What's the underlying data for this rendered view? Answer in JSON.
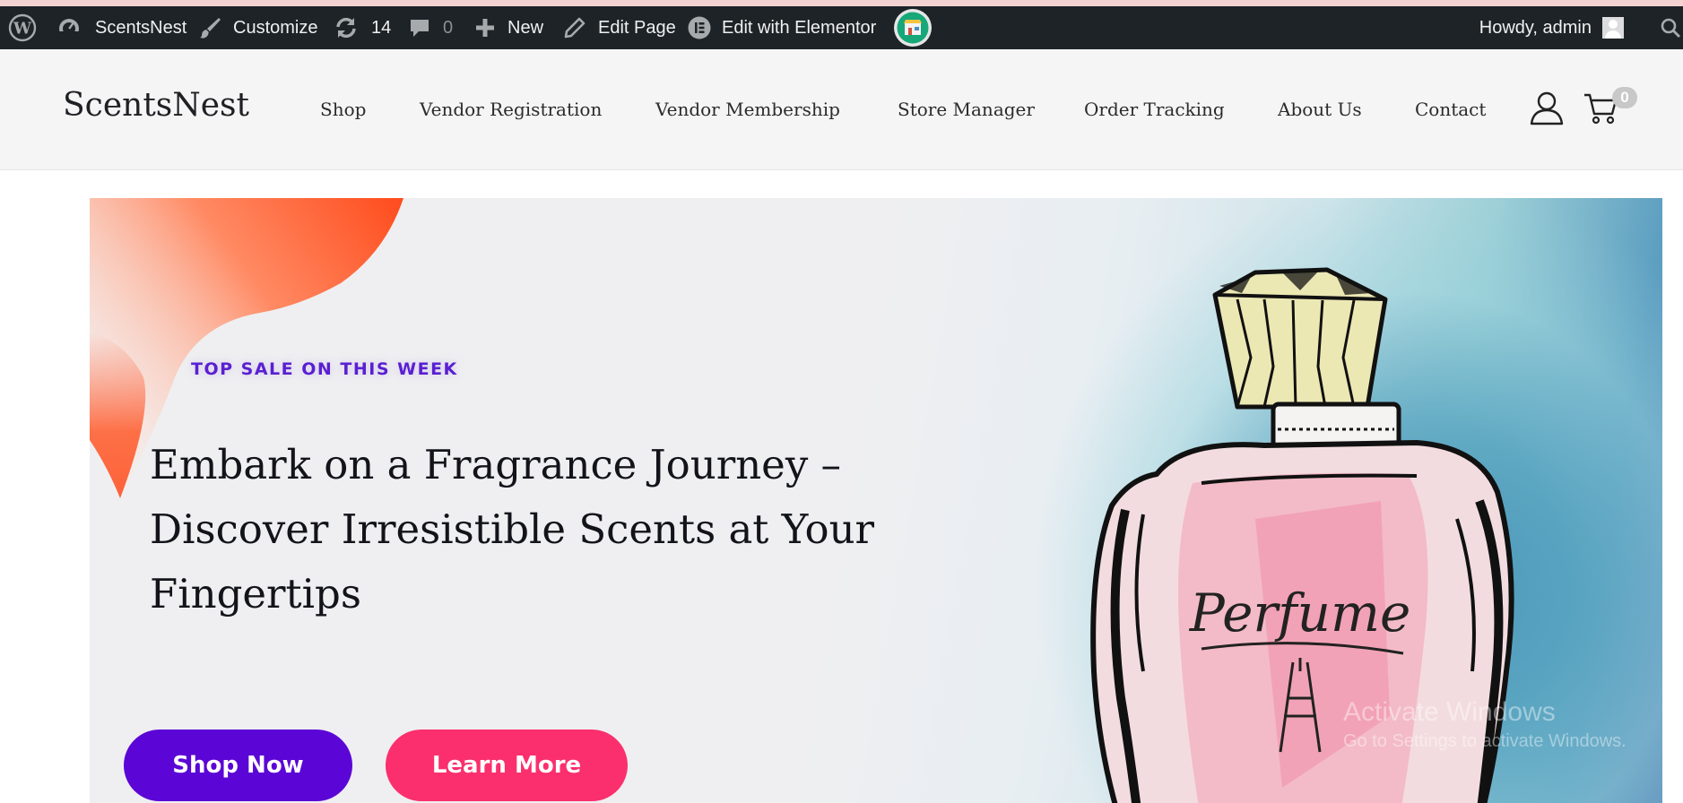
{
  "admin_bar": {
    "site_name": "ScentsNest",
    "customize": "Customize",
    "updates_count": "14",
    "comments_count": "0",
    "new": "New",
    "edit_page": "Edit Page",
    "edit_elementor": "Edit with Elementor",
    "howdy": "Howdy, admin"
  },
  "header": {
    "brand": "ScentsNest",
    "nav": [
      "Shop",
      "Vendor Registration",
      "Vendor Membership",
      "Store Manager",
      "Order Tracking",
      "About Us",
      "Contact"
    ],
    "cart_count": "0"
  },
  "hero": {
    "eyebrow": "TOP SALE ON THIS WEEK",
    "headline": "Embark on a Fragrance Journey – Discover Irresistible Scents at Your Fingertips",
    "bottle_label": "Perfume",
    "primary_button": "Shop Now",
    "secondary_button": "Learn More"
  },
  "watermark": {
    "title": "Activate Windows",
    "subtitle": "Go to Settings to activate Windows."
  },
  "colors": {
    "admin_bar_bg": "#1d2327",
    "eyebrow": "#5a1fd1",
    "shop_button": "#5b06d6",
    "learn_button": "#fb2f6d",
    "blob": "#ff4b1c"
  }
}
